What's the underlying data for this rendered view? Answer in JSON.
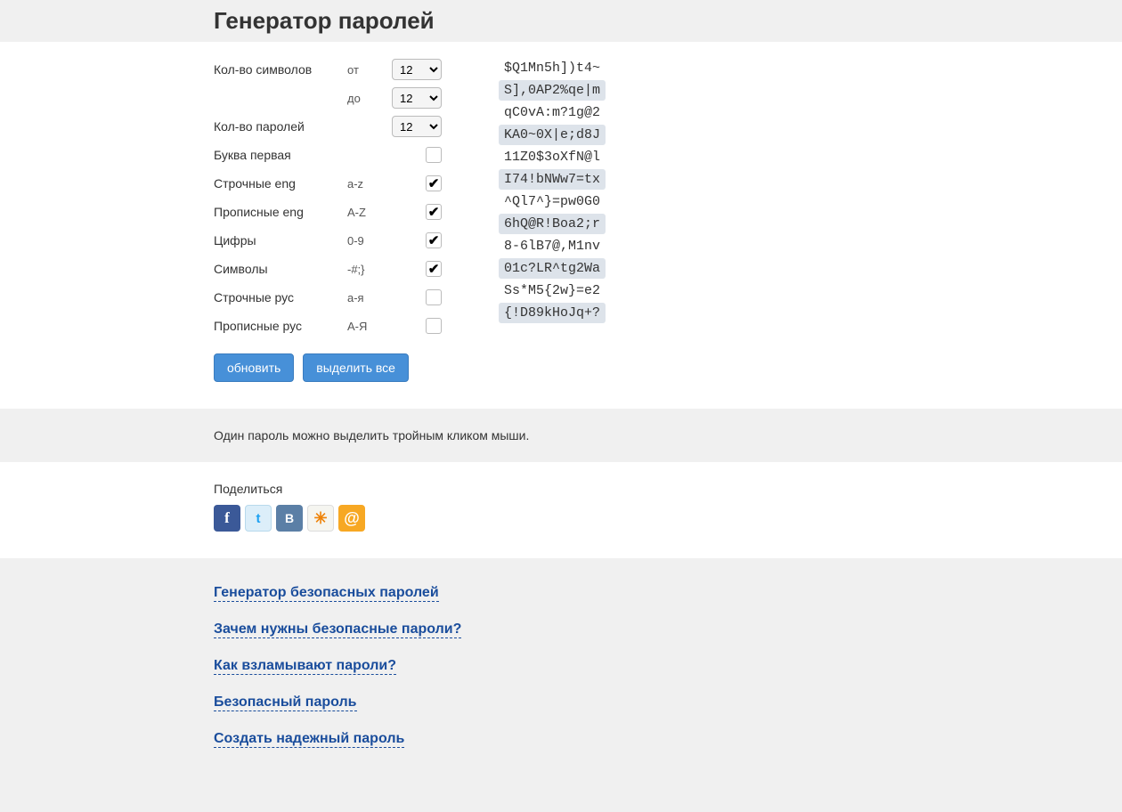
{
  "title": "Генератор паролей",
  "form": {
    "charCount": {
      "label": "Кол-во символов",
      "fromHint": "от",
      "toHint": "до",
      "fromValue": "12",
      "toValue": "12"
    },
    "pwCount": {
      "label": "Кол-во паролей",
      "value": "12"
    },
    "rows": [
      {
        "label": "Буква первая",
        "hint": "",
        "checked": false
      },
      {
        "label": "Строчные eng",
        "hint": "a-z",
        "checked": true
      },
      {
        "label": "Прописные eng",
        "hint": "A-Z",
        "checked": true
      },
      {
        "label": "Цифры",
        "hint": "0-9",
        "checked": true
      },
      {
        "label": "Символы",
        "hint": "-#;}",
        "checked": true
      },
      {
        "label": "Строчные рус",
        "hint": "а-я",
        "checked": false
      },
      {
        "label": "Прописные рус",
        "hint": "А-Я",
        "checked": false
      }
    ],
    "buttons": {
      "refresh": "обновить",
      "selectAll": "выделить все"
    }
  },
  "passwords": [
    "$Q1Mn5h])t4~",
    "S],0AP2%qe|m",
    "qC0vA:m?1g@2",
    "KA0~0X|e;d8J",
    "11Z0$3oXfN@l",
    "I74!bNWw7=tx",
    "^Ql7^}=pw0G0",
    "6hQ@R!Boa2;r",
    "8-6lB7@,M1nv",
    "01c?LR^tg2Wa",
    "Ss*M5{2w}=e2",
    "{!D89kHoJq+?"
  ],
  "hintText": "Один пароль можно выделить тройным кликом мыши.",
  "share": {
    "label": "Поделиться"
  },
  "faqLinks": [
    "Генератор безопасных паролей",
    "Зачем нужны безопасные пароли?",
    "Как взламывают пароли?",
    "Безопасный пароль",
    "Создать надежный пароль"
  ]
}
